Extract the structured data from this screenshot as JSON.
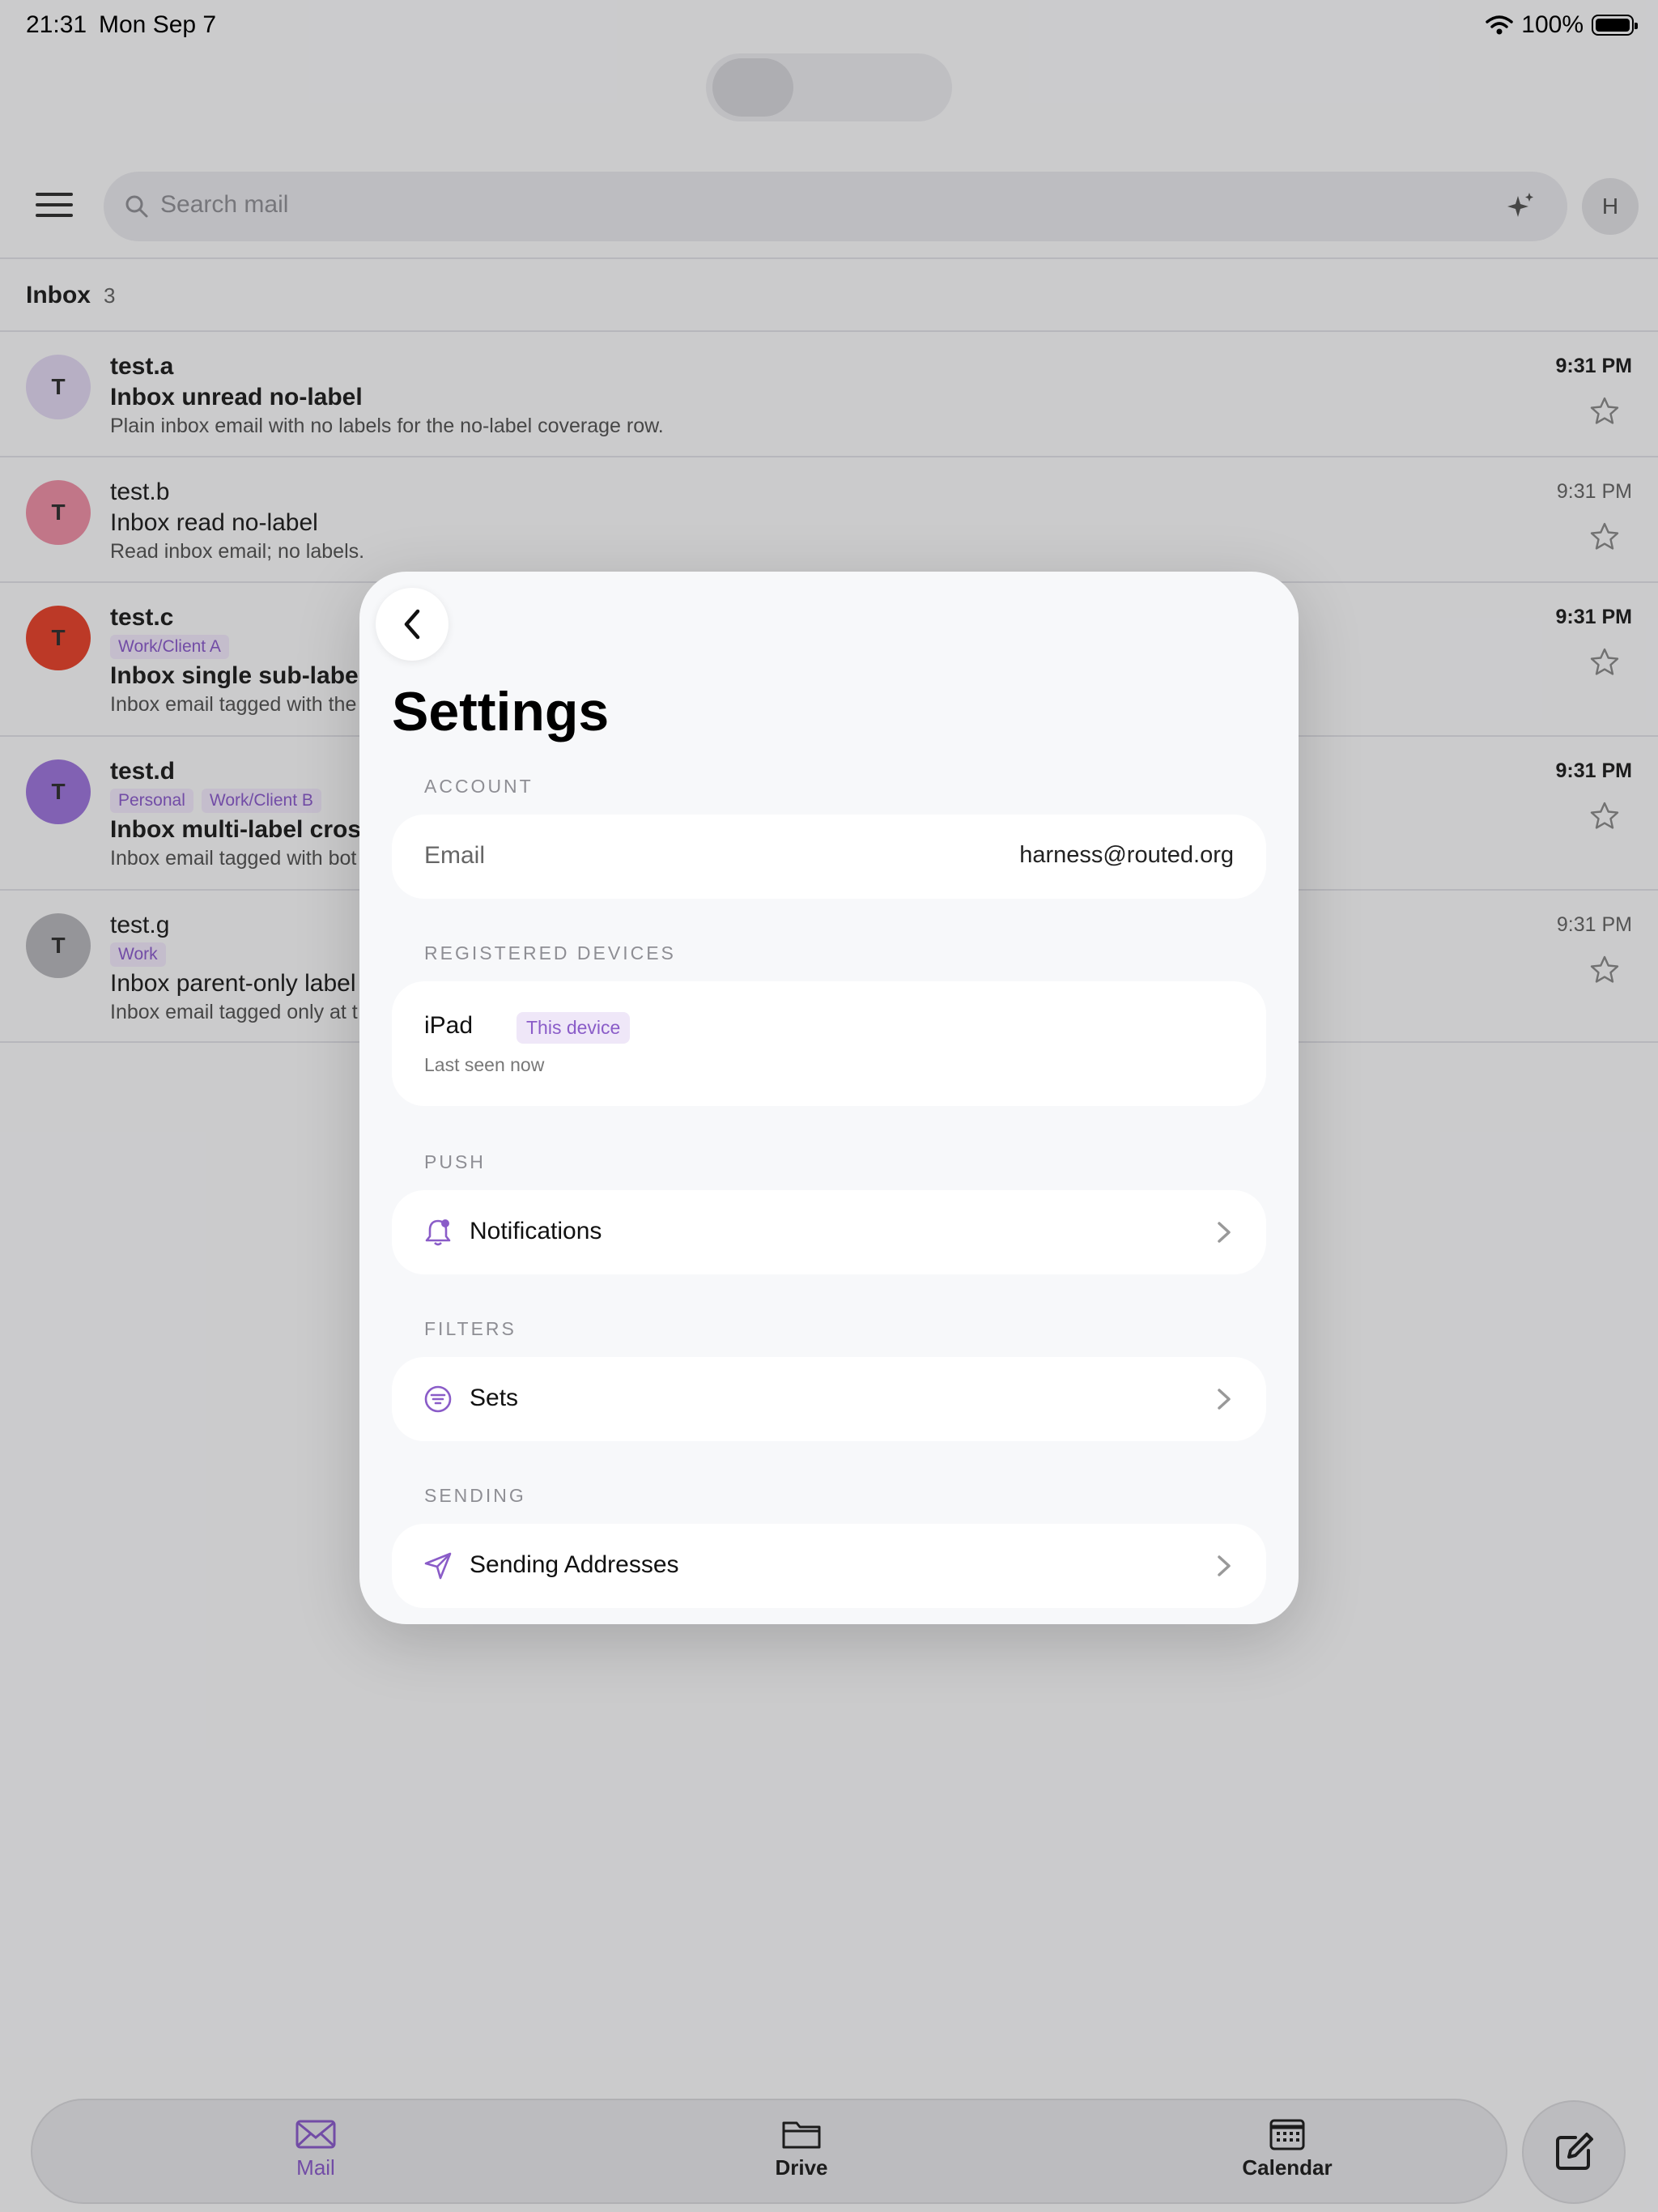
{
  "status_bar": {
    "time": "21:31",
    "date": "Mon Sep 7",
    "battery": "100%"
  },
  "toolbar": {
    "search_placeholder": "Search mail",
    "avatar_initial": "H"
  },
  "inbox": {
    "title": "Inbox",
    "count": "3"
  },
  "messages": [
    {
      "initial": "T",
      "avatar_color": "#dcd3ec",
      "sender": "test.a",
      "labels": [],
      "subject": "Inbox unread no-label",
      "snippet": "Plain inbox email with no labels for the no-label coverage row.",
      "time": "9:31 PM",
      "unread": true
    },
    {
      "initial": "T",
      "avatar_color": "#e98fa4",
      "sender": "test.b",
      "labels": [],
      "subject": "Inbox read no-label",
      "snippet": "Read inbox email; no labels.",
      "time": "9:31 PM",
      "unread": false
    },
    {
      "initial": "T",
      "avatar_color": "#e2452f",
      "sender": "test.c",
      "labels": [
        "Work/Client A"
      ],
      "subject": "Inbox single sub-label",
      "snippet": "Inbox email tagged with the",
      "time": "9:31 PM",
      "unread": true
    },
    {
      "initial": "T",
      "avatar_color": "#9c75d8",
      "sender": "test.d",
      "labels": [
        "Personal",
        "Work/Client B"
      ],
      "subject": "Inbox multi-label cross",
      "snippet": "Inbox email tagged with bot",
      "time": "9:31 PM",
      "unread": true
    },
    {
      "initial": "T",
      "avatar_color": "#b4b4b8",
      "sender": "test.g",
      "labels": [
        "Work"
      ],
      "subject": "Inbox parent-only label",
      "snippet": "Inbox email tagged only at t",
      "time": "9:31 PM",
      "unread": false
    }
  ],
  "settings": {
    "title": "Settings",
    "account": {
      "section": "ACCOUNT",
      "email_label": "Email",
      "email_value": "harness@routed.org"
    },
    "devices": {
      "section": "REGISTERED DEVICES",
      "device_name": "iPad",
      "badge": "This device",
      "last_seen": "Last seen now"
    },
    "push": {
      "section": "PUSH",
      "item": "Notifications",
      "icon": "bell-icon"
    },
    "filters": {
      "section": "FILTERS",
      "item": "Sets",
      "icon": "filter-icon"
    },
    "sending": {
      "section": "SENDING",
      "item": "Sending Addresses",
      "icon": "send-icon"
    }
  },
  "tabbar": {
    "mail": "Mail",
    "drive": "Drive",
    "calendar": "Calendar"
  },
  "colors": {
    "accent": "#8a5cc8"
  }
}
